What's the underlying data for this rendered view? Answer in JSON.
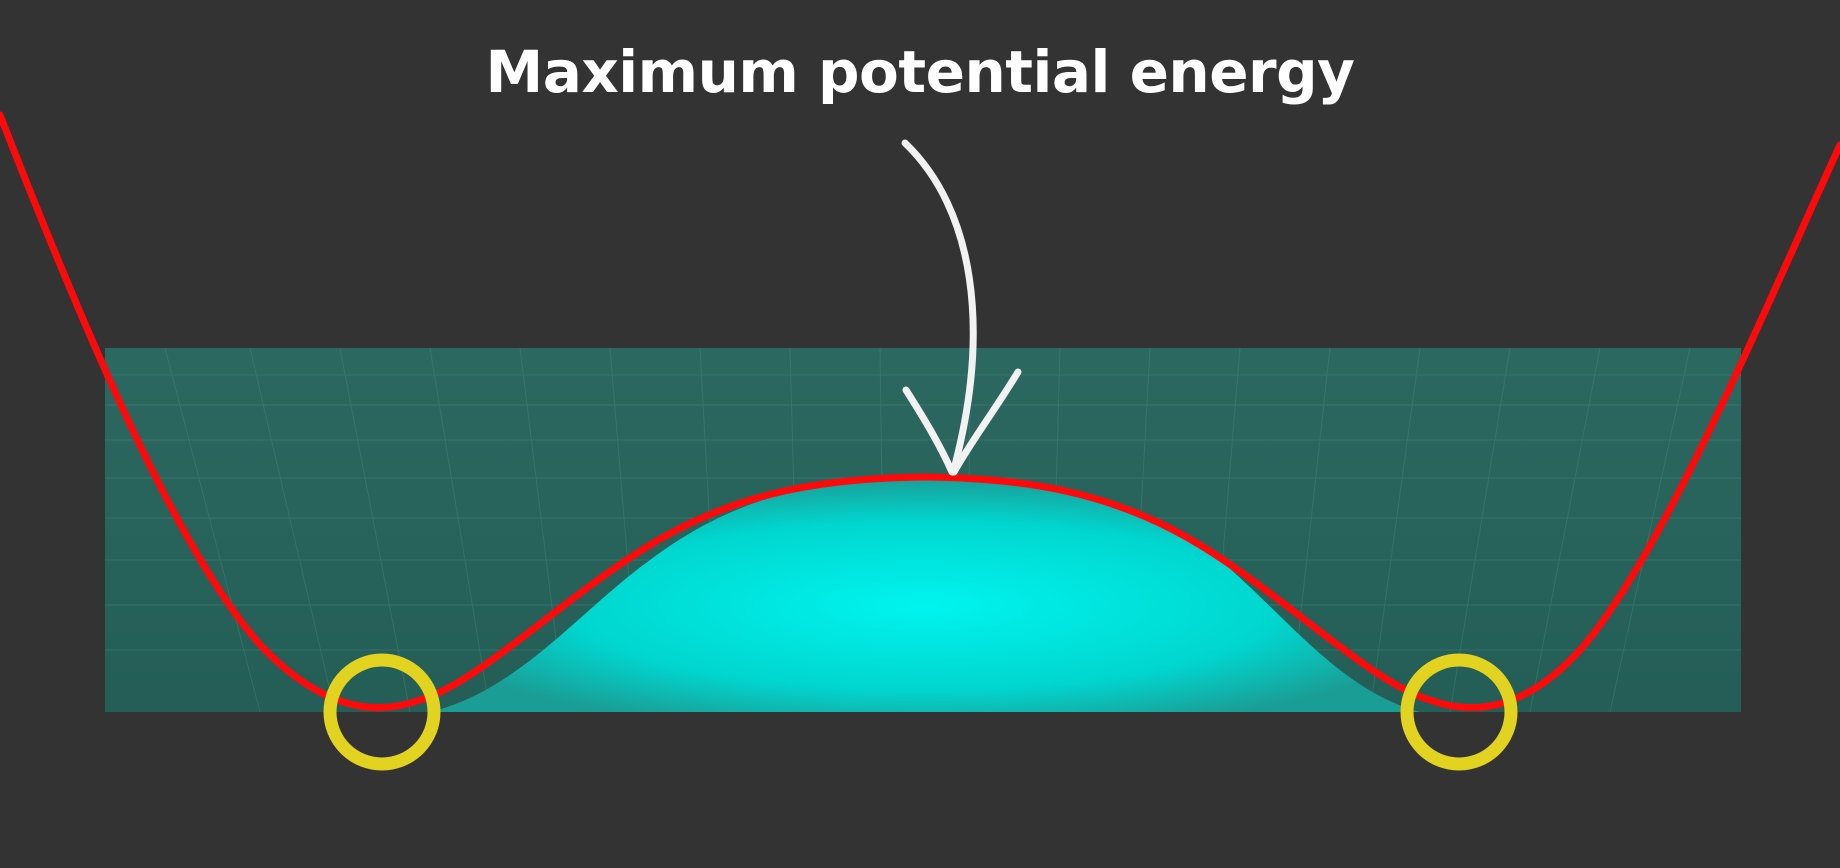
{
  "annotation": {
    "text": "Maximum potential energy"
  },
  "colors": {
    "background": "#333333",
    "curve": "#ff0a0a",
    "surface": "#2a6b62",
    "hill": "#00e8e0",
    "markers": "#e3d321",
    "arrow": "#f2f2f2",
    "text": "#ffffff"
  },
  "icons": {
    "arrow": "hand-drawn-down-arrow-icon",
    "markers": "minimum-circle-icon"
  }
}
